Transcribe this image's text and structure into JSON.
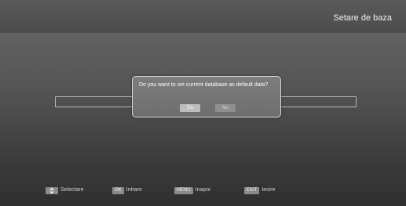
{
  "header": {
    "title": "Setare de baza"
  },
  "dialog": {
    "message": "Do you want to set current database as default data?",
    "yes_label": "Da",
    "no_label": "Nu"
  },
  "background": {
    "label": ""
  },
  "footer": {
    "select_key_icon": "up-down-arrows-icon",
    "select_label": "Selectare",
    "ok_key": "OK",
    "ok_label": "Intrare",
    "menu_key": "MENU",
    "menu_label": "Inapoi",
    "exit_key": "EXIT",
    "exit_label": "Iesire"
  }
}
